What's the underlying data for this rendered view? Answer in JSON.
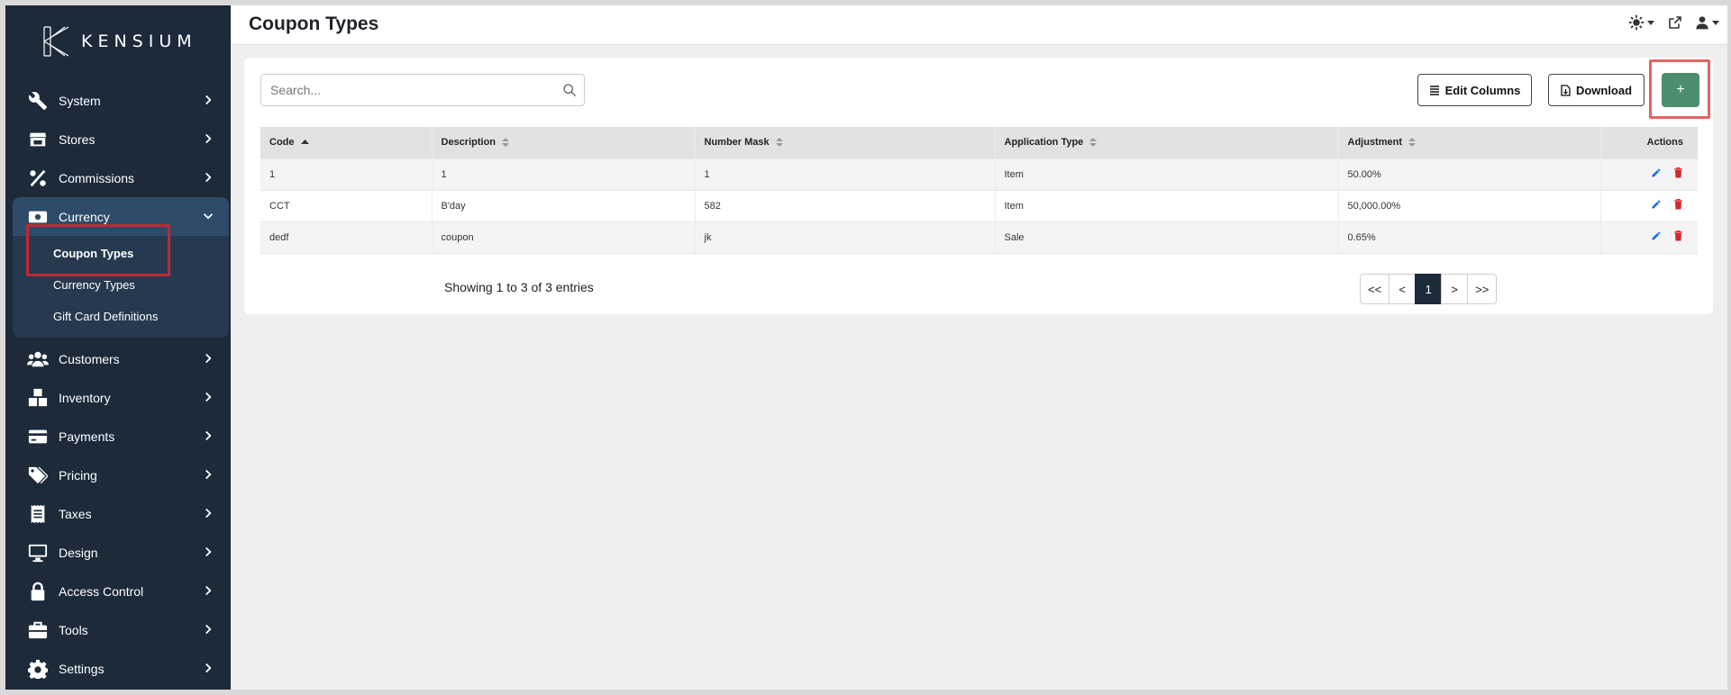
{
  "brand": {
    "name": "KENSIUM"
  },
  "sidebar": {
    "items": [
      {
        "label": "System",
        "icon": "wrench-icon"
      },
      {
        "label": "Stores",
        "icon": "store-icon"
      },
      {
        "label": "Commissions",
        "icon": "percent-icon"
      },
      {
        "label": "Currency",
        "icon": "money-icon",
        "expanded": true,
        "children": [
          {
            "label": "Coupon Types",
            "current": true
          },
          {
            "label": "Currency Types"
          },
          {
            "label": "Gift Card Definitions"
          }
        ]
      },
      {
        "label": "Customers",
        "icon": "users-icon"
      },
      {
        "label": "Inventory",
        "icon": "boxes-icon"
      },
      {
        "label": "Payments",
        "icon": "credit-card-icon"
      },
      {
        "label": "Pricing",
        "icon": "tags-icon"
      },
      {
        "label": "Taxes",
        "icon": "receipt-icon"
      },
      {
        "label": "Design",
        "icon": "monitor-icon"
      },
      {
        "label": "Access Control",
        "icon": "lock-icon"
      },
      {
        "label": "Tools",
        "icon": "toolbox-icon"
      },
      {
        "label": "Settings",
        "icon": "gear-icon"
      }
    ]
  },
  "header": {
    "title": "Coupon Types"
  },
  "toolbar": {
    "search_placeholder": "Search...",
    "edit_columns_label": "Edit Columns",
    "download_label": "Download",
    "add_label": "+"
  },
  "table": {
    "columns": [
      "Code",
      "Description",
      "Number Mask",
      "Application Type",
      "Adjustment",
      "Actions"
    ],
    "rows": [
      {
        "code": "1",
        "description": "1",
        "number_mask": "1",
        "application_type": "Item",
        "adjustment": "50.00%"
      },
      {
        "code": "CCT",
        "description": "B'day",
        "number_mask": "582",
        "application_type": "Item",
        "adjustment": "50,000.00%"
      },
      {
        "code": "dedf",
        "description": "coupon",
        "number_mask": "jk",
        "application_type": "Sale",
        "adjustment": "0.65%"
      }
    ]
  },
  "footer": {
    "entries_text": "Showing 1 to 3 of 3 entries",
    "pager": {
      "first": "<<",
      "prev": "<",
      "current": "1",
      "next": ">",
      "last": ">>"
    }
  },
  "colors": {
    "sidebar": "#1c2a3a",
    "add_button": "#4d8e6e",
    "highlight": "#e86262"
  }
}
